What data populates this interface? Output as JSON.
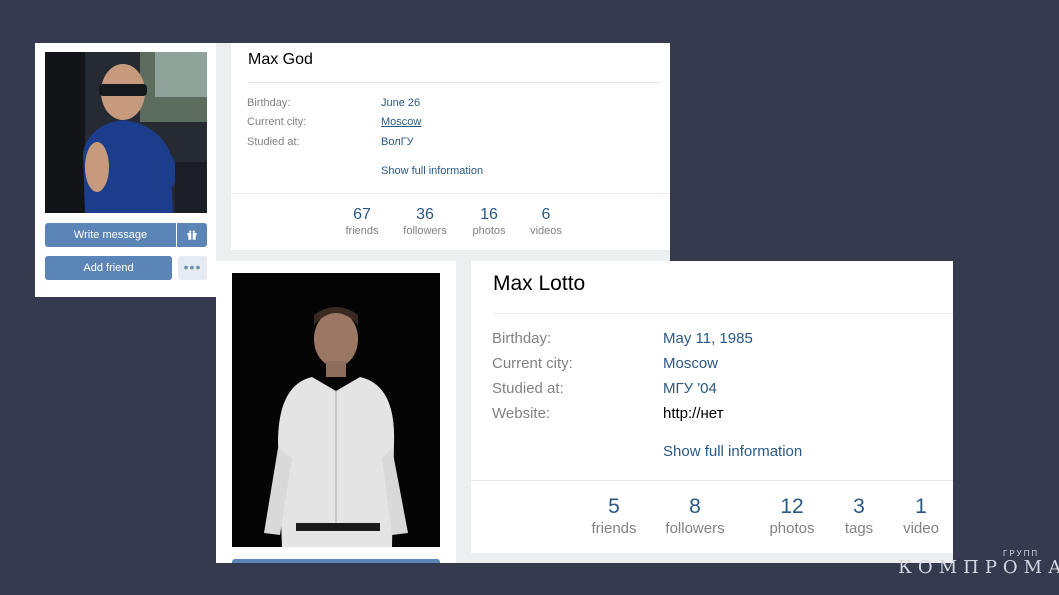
{
  "profile1": {
    "name": "Max God",
    "fields": [
      {
        "label": "Birthday:",
        "value": "June 26"
      },
      {
        "label": "Current city:",
        "value": "Moscow"
      },
      {
        "label": "Studied at:",
        "value": "ВолГУ"
      }
    ],
    "show_full": "Show full information",
    "stats": [
      {
        "count": "67",
        "label": "friends"
      },
      {
        "count": "36",
        "label": "followers"
      },
      {
        "count": "16",
        "label": "photos"
      },
      {
        "count": "6",
        "label": "videos"
      }
    ],
    "write_message": "Write message",
    "gift_icon": "gift-icon",
    "add_friend": "Add friend",
    "more": "•••"
  },
  "profile2": {
    "name": "Max Lotto",
    "fields": [
      {
        "label": "Birthday:",
        "value": "May 11, 1985"
      },
      {
        "label": "Current city:",
        "value": "Moscow"
      },
      {
        "label": "Studied at:",
        "value": "МГУ '04"
      },
      {
        "label": "Website:",
        "value": "http://нет"
      }
    ],
    "show_full": "Show full information",
    "stats": [
      {
        "count": "5",
        "label": "friends"
      },
      {
        "count": "8",
        "label": "followers"
      },
      {
        "count": "12",
        "label": "photos"
      },
      {
        "count": "3",
        "label": "tags"
      },
      {
        "count": "1",
        "label": "video"
      }
    ]
  },
  "watermark": {
    "main": "КОМПРОМАТ",
    "sub": "ГРУПП"
  },
  "colors": {
    "background": "#363a4f",
    "link": "#2a5885",
    "button": "#5b85b6"
  }
}
